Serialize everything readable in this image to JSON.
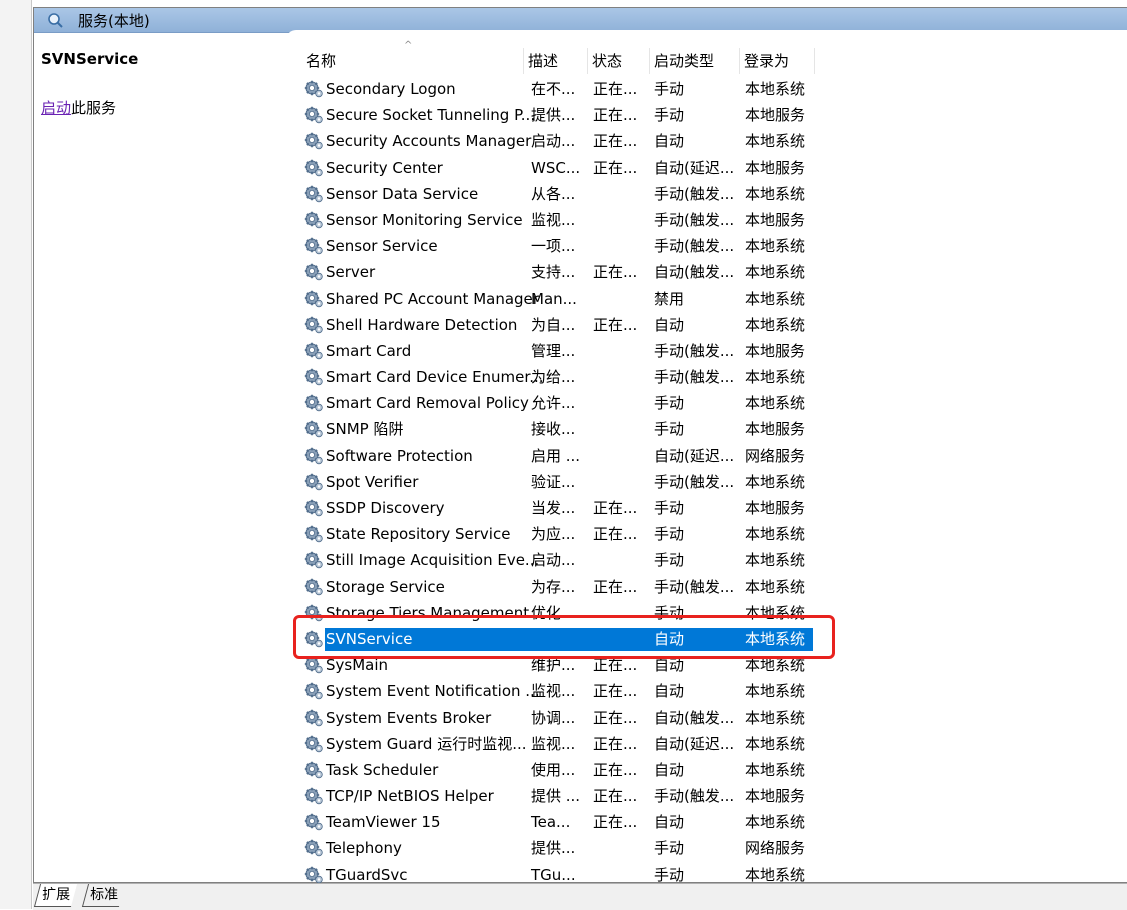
{
  "panel": {
    "title": "服务(本地)",
    "selected_name": "SVNService",
    "action_link": "启动",
    "action_suffix": "此服务"
  },
  "columns": [
    "名称",
    "描述",
    "状态",
    "启动类型",
    "登录为"
  ],
  "services": [
    {
      "name": "Secondary Logon",
      "desc": "在不...",
      "status": "正在...",
      "type": "手动",
      "logon": "本地系统"
    },
    {
      "name": "Secure Socket Tunneling P...",
      "desc": "提供...",
      "status": "正在...",
      "type": "手动",
      "logon": "本地服务"
    },
    {
      "name": "Security Accounts Manager",
      "desc": "启动...",
      "status": "正在...",
      "type": "自动",
      "logon": "本地系统"
    },
    {
      "name": "Security Center",
      "desc": "WSC...",
      "status": "正在...",
      "type": "自动(延迟...",
      "logon": "本地服务"
    },
    {
      "name": "Sensor Data Service",
      "desc": "从各...",
      "status": "",
      "type": "手动(触发...",
      "logon": "本地系统"
    },
    {
      "name": "Sensor Monitoring Service",
      "desc": "监视...",
      "status": "",
      "type": "手动(触发...",
      "logon": "本地服务"
    },
    {
      "name": "Sensor Service",
      "desc": "一项...",
      "status": "",
      "type": "手动(触发...",
      "logon": "本地系统"
    },
    {
      "name": "Server",
      "desc": "支持...",
      "status": "正在...",
      "type": "自动(触发...",
      "logon": "本地系统"
    },
    {
      "name": "Shared PC Account Manager",
      "desc": "Man...",
      "status": "",
      "type": "禁用",
      "logon": "本地系统"
    },
    {
      "name": "Shell Hardware Detection",
      "desc": "为自...",
      "status": "正在...",
      "type": "自动",
      "logon": "本地系统"
    },
    {
      "name": "Smart Card",
      "desc": "管理...",
      "status": "",
      "type": "手动(触发...",
      "logon": "本地服务"
    },
    {
      "name": "Smart Card Device Enumer...",
      "desc": "为给...",
      "status": "",
      "type": "手动(触发...",
      "logon": "本地系统"
    },
    {
      "name": "Smart Card Removal Policy",
      "desc": "允许...",
      "status": "",
      "type": "手动",
      "logon": "本地系统"
    },
    {
      "name": "SNMP 陷阱",
      "desc": "接收...",
      "status": "",
      "type": "手动",
      "logon": "本地服务"
    },
    {
      "name": "Software Protection",
      "desc": "启用 ...",
      "status": "",
      "type": "自动(延迟...",
      "logon": "网络服务"
    },
    {
      "name": "Spot Verifier",
      "desc": "验证...",
      "status": "",
      "type": "手动(触发...",
      "logon": "本地系统"
    },
    {
      "name": "SSDP Discovery",
      "desc": "当发...",
      "status": "正在...",
      "type": "手动",
      "logon": "本地服务"
    },
    {
      "name": "State Repository Service",
      "desc": "为应...",
      "status": "正在...",
      "type": "手动",
      "logon": "本地系统"
    },
    {
      "name": "Still Image Acquisition Eve...",
      "desc": "启动...",
      "status": "",
      "type": "手动",
      "logon": "本地系统"
    },
    {
      "name": "Storage Service",
      "desc": "为存...",
      "status": "正在...",
      "type": "手动(触发...",
      "logon": "本地系统"
    },
    {
      "name": "Storage Tiers Management",
      "desc": "优化...",
      "status": "",
      "type": "手动",
      "logon": "本地系统"
    },
    {
      "name": "SVNService",
      "desc": "",
      "status": "",
      "type": "自动",
      "logon": "本地系统",
      "selected": true
    },
    {
      "name": "SysMain",
      "desc": "维护...",
      "status": "正在...",
      "type": "自动",
      "logon": "本地系统"
    },
    {
      "name": "System Event Notification ...",
      "desc": "监视...",
      "status": "正在...",
      "type": "自动",
      "logon": "本地系统"
    },
    {
      "name": "System Events Broker",
      "desc": "协调...",
      "status": "正在...",
      "type": "自动(触发...",
      "logon": "本地系统"
    },
    {
      "name": "System Guard 运行时监视...",
      "desc": "监视...",
      "status": "正在...",
      "type": "自动(延迟...",
      "logon": "本地系统"
    },
    {
      "name": "Task Scheduler",
      "desc": "使用...",
      "status": "正在...",
      "type": "自动",
      "logon": "本地系统"
    },
    {
      "name": "TCP/IP NetBIOS Helper",
      "desc": "提供 ...",
      "status": "正在...",
      "type": "手动(触发...",
      "logon": "本地服务"
    },
    {
      "name": "TeamViewer 15",
      "desc": "Tea...",
      "status": "正在...",
      "type": "自动",
      "logon": "本地系统"
    },
    {
      "name": "Telephony",
      "desc": "提供...",
      "status": "",
      "type": "手动",
      "logon": "网络服务"
    },
    {
      "name": "TGuardSvc",
      "desc": "TGu...",
      "status": "",
      "type": "手动",
      "logon": "本地系统"
    }
  ],
  "tabs": [
    "扩展",
    "标准"
  ],
  "colors": {
    "selection": "#0078d7",
    "highlight": "#e8221e",
    "link": "#6a22b3"
  }
}
